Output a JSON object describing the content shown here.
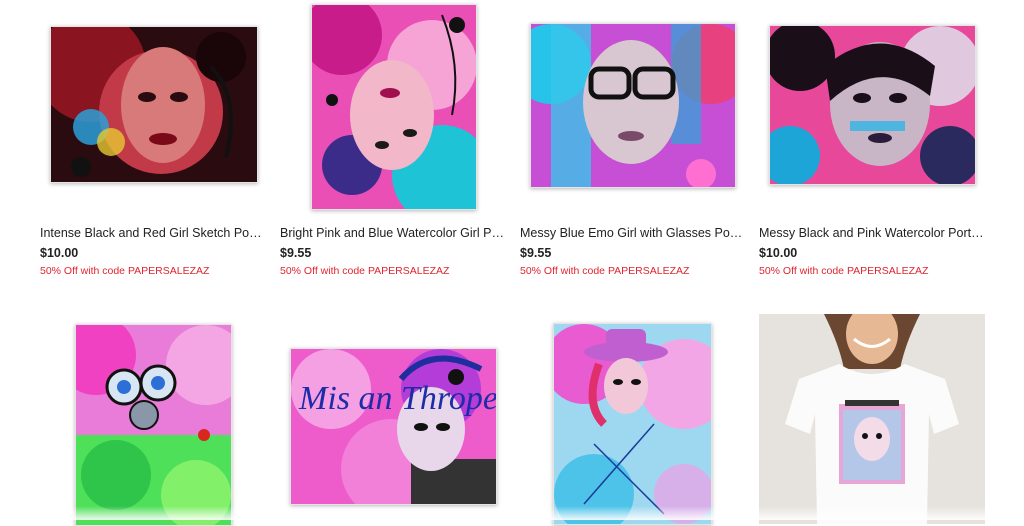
{
  "products": [
    {
      "title": "Intense Black and Red Girl Sketch Poster",
      "price": "$10.00",
      "promo": "50% Off with code PAPERSALEZAZ",
      "image": "intense-red-girl-poster"
    },
    {
      "title": "Bright Pink and Blue Watercolor Girl Poster",
      "price": "$9.55",
      "promo": "50% Off with code PAPERSALEZAZ",
      "image": "pink-blue-upside-down-girl-poster"
    },
    {
      "title": "Messy Blue Emo Girl with Glasses Poster",
      "price": "$9.55",
      "promo": "50% Off with code PAPERSALEZAZ",
      "image": "blue-emo-glasses-girl-poster"
    },
    {
      "title": "Messy Black and Pink Watercolor Portrait Poster",
      "price": "$10.00",
      "promo": "50% Off with code PAPERSALEZAZ",
      "image": "black-pink-portrait-poster"
    },
    {
      "image": "gas-mask-girl-poster"
    },
    {
      "image": "misanthrope-poster",
      "image_text": "Mis an Thrope!"
    },
    {
      "image": "pink-hat-girl-poster"
    },
    {
      "image": "white-tshirt-model",
      "product": "t-shirt"
    }
  ],
  "colors": {
    "promo": "#e0242f",
    "price": "#222222",
    "title": "#222222"
  }
}
